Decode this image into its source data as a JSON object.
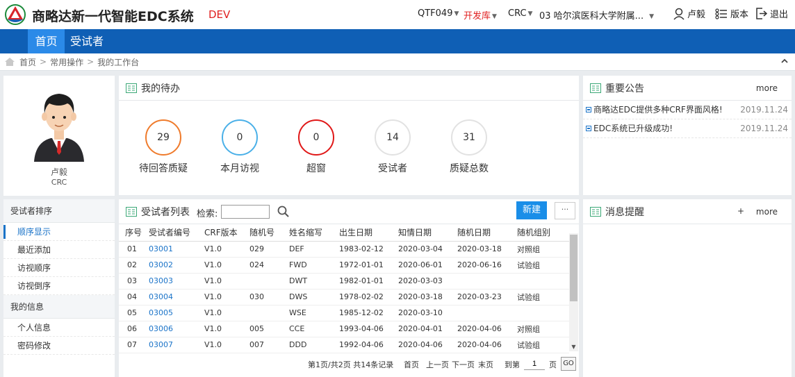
{
  "header": {
    "app_title": "商略达新一代智能EDC系统",
    "env_tag": "DEV",
    "project": "QTF049",
    "database": "开发库",
    "role": "CRC",
    "site": "03 哈尔滨医科大学附属...",
    "user": "卢毅",
    "version_label": "版本",
    "logout_label": "退出"
  },
  "nav": {
    "home": "首页",
    "subjects": "受试者"
  },
  "breadcrumb": {
    "home": "首页",
    "ops": "常用操作",
    "current": "我的工作台",
    "sep": ">"
  },
  "profile": {
    "name": "卢毅",
    "role": "CRC"
  },
  "leftmenu": {
    "group1": "受试者排序",
    "items1": [
      "顺序显示",
      "最近添加",
      "访视顺序",
      "访视倒序"
    ],
    "group2": "我的信息",
    "items2": [
      "个人信息",
      "密码修改"
    ]
  },
  "todo": {
    "title": "我的待办",
    "cards": [
      {
        "value": "29",
        "label": "待回答质疑",
        "color": "#ef7b2c"
      },
      {
        "value": "0",
        "label": "本月访视",
        "color": "#4ab0e8"
      },
      {
        "value": "0",
        "label": "超窗",
        "color": "#e01818"
      },
      {
        "value": "14",
        "label": "受试者",
        "color": "#e2e2e2"
      },
      {
        "value": "31",
        "label": "质疑总数",
        "color": "#e2e2e2"
      }
    ]
  },
  "notice": {
    "title": "重要公告",
    "more": "more",
    "items": [
      {
        "text": "商略达EDC提供多种CRF界面风格!",
        "date": "2019.11.24"
      },
      {
        "text": "EDC系统已升级成功!",
        "date": "2019.11.24"
      }
    ]
  },
  "subjects": {
    "title": "受试者列表",
    "search_label": "检索:",
    "search_value": "",
    "new_button": "新建",
    "more_button": "···",
    "columns": [
      "序号",
      "受试者编号",
      "CRF版本",
      "随机号",
      "姓名缩写",
      "出生日期",
      "知情日期",
      "随机日期",
      "随机组别"
    ],
    "rows": [
      [
        "01",
        "03001",
        "V1.0",
        "029",
        "DEF",
        "1983-02-12",
        "2020-03-04",
        "2020-03-18",
        "对照组"
      ],
      [
        "02",
        "03002",
        "V1.0",
        "024",
        "FWD",
        "1972-01-01",
        "2020-06-01",
        "2020-06-16",
        "试验组"
      ],
      [
        "03",
        "03003",
        "V1.0",
        "",
        "DWT",
        "1982-01-01",
        "2020-03-03",
        "",
        ""
      ],
      [
        "04",
        "03004",
        "V1.0",
        "030",
        "DWS",
        "1978-02-02",
        "2020-03-18",
        "2020-03-23",
        "试验组"
      ],
      [
        "05",
        "03005",
        "V1.0",
        "",
        "WSE",
        "1985-12-02",
        "2020-03-10",
        "",
        ""
      ],
      [
        "06",
        "03006",
        "V1.0",
        "005",
        "CCE",
        "1993-04-06",
        "2020-04-01",
        "2020-04-06",
        "对照组"
      ],
      [
        "07",
        "03007",
        "V1.0",
        "007",
        "DDD",
        "1992-04-06",
        "2020-04-06",
        "2020-04-06",
        "试验组"
      ]
    ],
    "pager": {
      "summary": "第1页/共2页 共14条记录",
      "first": "首页",
      "prev": "上一页",
      "next": "下一页",
      "last": "末页",
      "goto_label": "到第",
      "page_value": "1",
      "page_unit": "页",
      "go": "GO"
    }
  },
  "messages": {
    "title": "消息提醒",
    "plus": "+",
    "more": "more"
  }
}
